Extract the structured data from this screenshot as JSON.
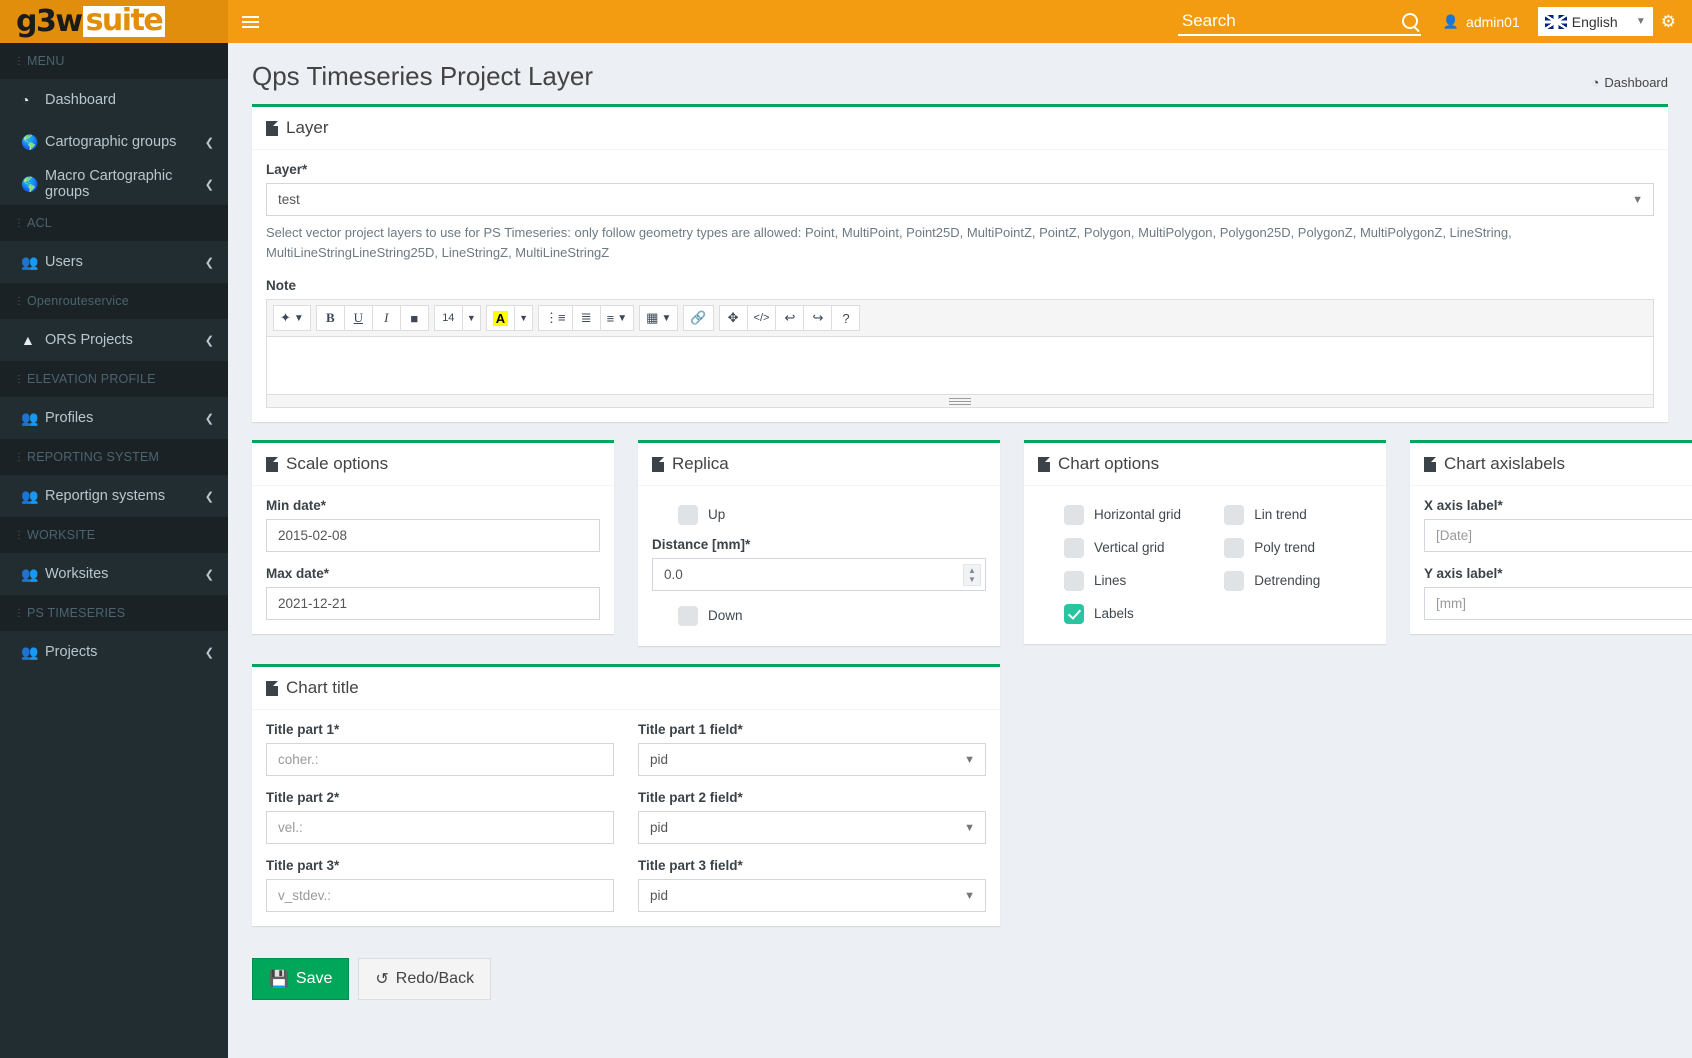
{
  "brand": {
    "logo_main": "g3w",
    "logo_suite": "suite"
  },
  "header": {
    "hamburger_icon": "hamburger-icon",
    "search_placeholder": "Search",
    "search_value": "",
    "search_icon": "search-icon",
    "user_icon": "user-icon",
    "username": "admin01",
    "language": "English",
    "lang_caret_icon": "chevron-down-icon",
    "gear_icon": "gear-icon"
  },
  "sidebar": {
    "sections": [
      {
        "heading": "MENU",
        "items": [
          {
            "label": "Dashboard",
            "icon": "dashboard-icon",
            "chevron": false
          },
          {
            "label": "Cartographic groups",
            "icon": "globe-icon",
            "chevron": true
          },
          {
            "label": "Macro Cartographic groups",
            "icon": "globe-icon",
            "chevron": true
          }
        ]
      },
      {
        "heading": "ACL",
        "items": [
          {
            "label": "Users",
            "icon": "users-icon",
            "chevron": true
          }
        ]
      },
      {
        "heading": "Openrouteservice",
        "items": [
          {
            "label": "ORS Projects",
            "icon": "road-icon",
            "chevron": true
          }
        ]
      },
      {
        "heading": "ELEVATION PROFILE",
        "items": [
          {
            "label": "Profiles",
            "icon": "users-icon",
            "chevron": true
          }
        ]
      },
      {
        "heading": "REPORTING SYSTEM",
        "items": [
          {
            "label": "Reportign systems",
            "icon": "users-icon",
            "chevron": true
          }
        ]
      },
      {
        "heading": "WORKSITE",
        "items": [
          {
            "label": "Worksites",
            "icon": "users-icon",
            "chevron": true
          }
        ]
      },
      {
        "heading": "PS TIMESERIES",
        "items": [
          {
            "label": "Projects",
            "icon": "users-icon",
            "chevron": true
          }
        ]
      }
    ]
  },
  "page": {
    "title": "Qps Timeseries Project Layer",
    "breadcrumb_icon": "dashboard-icon",
    "breadcrumb_label": "Dashboard"
  },
  "layer_box": {
    "title": "Layer",
    "layer_label": "Layer*",
    "layer_value": "test",
    "layer_caret_icon": "chevron-down-icon",
    "help": "Select vector project layers to use for PS Timeseries: only follow geometry types are allowed: Point, MultiPoint, Point25D, MultiPointZ, PointZ, Polygon, MultiPolygon, Polygon25D, PolygonZ, MultiPolygonZ, LineString, MultiLineStringLineString25D, LineStringZ, MultiLineStringZ",
    "note_label": "Note",
    "note_value": "",
    "toolbar": [
      {
        "group": [
          {
            "glyph": "✨",
            "name": "style-magic-icon",
            "caret": true
          }
        ]
      },
      {
        "group": [
          {
            "glyph": "B",
            "name": "bold-icon",
            "bold": true
          },
          {
            "glyph": "U",
            "name": "underline-icon",
            "underline": true
          },
          {
            "glyph": "I",
            "name": "italic-icon",
            "italic": true
          },
          {
            "glyph": "⌸",
            "name": "eraser-icon"
          }
        ]
      },
      {
        "group": [
          {
            "glyph": "14",
            "name": "font-size-selector",
            "caret": true,
            "small": true
          }
        ]
      },
      {
        "group": [
          {
            "glyph": "A",
            "name": "text-color-icon",
            "highlight": true
          },
          {
            "glyph": "",
            "name": "color-dropdown-icon",
            "caret": true
          }
        ]
      },
      {
        "group": [
          {
            "glyph": "☰",
            "name": "unordered-list-icon"
          },
          {
            "glyph": "≣",
            "name": "ordered-list-icon"
          },
          {
            "glyph": "≡",
            "name": "paragraph-align-icon",
            "caret": true
          }
        ]
      },
      {
        "group": [
          {
            "glyph": "▦",
            "name": "table-icon",
            "caret": true
          }
        ]
      },
      {
        "group": [
          {
            "glyph": "⚭",
            "name": "link-icon"
          }
        ]
      },
      {
        "group": [
          {
            "glyph": "✥",
            "name": "fullscreen-icon"
          },
          {
            "glyph": "</>",
            "name": "code-view-icon"
          },
          {
            "glyph": "↶",
            "name": "undo-icon"
          },
          {
            "glyph": "↷",
            "name": "redo-icon"
          },
          {
            "glyph": "?",
            "name": "help-icon"
          }
        ]
      }
    ],
    "resize_handle_icon": "resize-grip-icon"
  },
  "scale_options": {
    "title": "Scale options",
    "min_date_label": "Min date*",
    "min_date_value": "2015-02-08",
    "max_date_label": "Max date*",
    "max_date_value": "2021-12-21"
  },
  "replica": {
    "title": "Replica",
    "up_label": "Up",
    "up_checked": false,
    "distance_label": "Distance [mm]*",
    "distance_value": "0.0",
    "down_label": "Down",
    "down_checked": false,
    "spinner_icon": "stepper-icon"
  },
  "chart_options": {
    "title": "Chart options",
    "left": [
      {
        "label": "Horizontal grid",
        "checked": false
      },
      {
        "label": "Vertical grid",
        "checked": false
      },
      {
        "label": "Lines",
        "checked": false
      },
      {
        "label": "Labels",
        "checked": true
      }
    ],
    "right": [
      {
        "label": "Lin trend",
        "checked": false
      },
      {
        "label": "Poly trend",
        "checked": false
      },
      {
        "label": "Detrending",
        "checked": false
      }
    ],
    "checked_color": "#2bc4a0"
  },
  "chart_axislabels": {
    "title": "Chart axislabels",
    "x_label": "X axis label*",
    "x_value": "[Date]",
    "y_label": "Y axis label*",
    "y_value": "[mm]"
  },
  "chart_title": {
    "title": "Chart title",
    "rows": [
      {
        "part_label": "Title part 1*",
        "part_value": "coher.:",
        "field_label": "Title part 1 field*",
        "field_value": "pid"
      },
      {
        "part_label": "Title part 2*",
        "part_value": "vel.:",
        "field_label": "Title part 2 field*",
        "field_value": "pid"
      },
      {
        "part_label": "Title part 3*",
        "part_value": "v_stdev.:",
        "field_label": "Title part 3 field*",
        "field_value": "pid"
      }
    ]
  },
  "footer": {
    "save_label": "Save",
    "save_icon": "floppy-icon",
    "redo_label": "Redo/Back",
    "redo_icon": "undo-circle-icon"
  },
  "colors": {
    "brand_orange": "#f39c12",
    "logo_orange": "#e08e0b",
    "sidebar_dark": "#222d32",
    "accent_green": "#00a65a",
    "check_teal": "#2bc4a0",
    "page_bg": "#ecf0f5"
  }
}
